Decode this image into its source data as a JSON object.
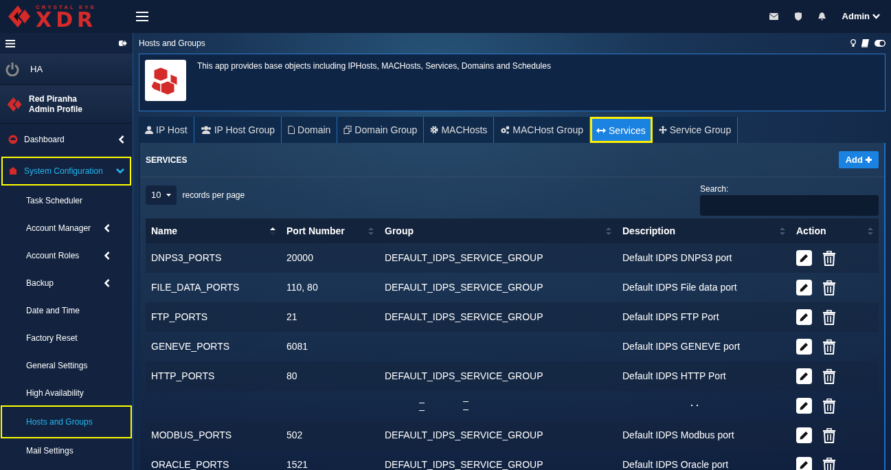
{
  "logo": {
    "top": "CRYSTAL EYE",
    "main": "XDR"
  },
  "topbar": {
    "user": "Admin"
  },
  "sidebar": {
    "ha": "HA",
    "profile": {
      "name": "Red Piranha",
      "role": "Admin Profile"
    },
    "items": [
      {
        "label": "Dashboard",
        "selected": false,
        "expanded": false,
        "has_children": true
      },
      {
        "label": "System Configuration",
        "selected": true,
        "expanded": true,
        "has_children": true,
        "children": [
          {
            "label": "Task Scheduler",
            "selected": false,
            "has_children": false
          },
          {
            "label": "Account Manager",
            "selected": false,
            "has_children": true
          },
          {
            "label": "Account Roles",
            "selected": false,
            "has_children": true
          },
          {
            "label": "Backup",
            "selected": false,
            "has_children": true
          },
          {
            "label": "Date and Time",
            "selected": false,
            "has_children": false
          },
          {
            "label": "Factory Reset",
            "selected": false,
            "has_children": false
          },
          {
            "label": "General Settings",
            "selected": false,
            "has_children": false
          },
          {
            "label": "High Availability",
            "selected": false,
            "has_children": false
          },
          {
            "label": "Hosts and Groups",
            "selected": true,
            "has_children": false
          },
          {
            "label": "Mail Settings",
            "selected": false,
            "has_children": false
          }
        ]
      }
    ]
  },
  "page": {
    "title": "Hosts and Groups",
    "info": "This app provides base objects including IPHosts, MACHosts, Services, Domains and Schedules"
  },
  "tabs": [
    {
      "label": "IP Host",
      "selected": false
    },
    {
      "label": "IP Host Group",
      "selected": false
    },
    {
      "label": "Domain",
      "selected": false
    },
    {
      "label": "Domain Group",
      "selected": false
    },
    {
      "label": "MACHosts",
      "selected": false
    },
    {
      "label": "MACHost Group",
      "selected": false
    },
    {
      "label": "Services",
      "selected": true
    },
    {
      "label": "Service Group",
      "selected": false
    }
  ],
  "panel": {
    "title": "SERVICES",
    "add_button": "Add",
    "page_size": "10",
    "page_size_label": "records per page",
    "search_label": "Search:"
  },
  "table": {
    "columns": [
      {
        "label": "Name",
        "sorted": true
      },
      {
        "label": "Port Number",
        "sorted": false
      },
      {
        "label": "Group",
        "sorted": false
      },
      {
        "label": "Description",
        "sorted": false
      },
      {
        "label": "Action",
        "sorted": false
      }
    ],
    "rows": [
      {
        "name": "DNPS3_PORTS",
        "port": "20000",
        "group": "DEFAULT_IDPS_SERVICE_GROUP",
        "description": "Default IDPS DNPS3 port"
      },
      {
        "name": "FILE_DATA_PORTS",
        "port": "110, 80",
        "group": "DEFAULT_IDPS_SERVICE_GROUP",
        "description": "Default IDPS File data port"
      },
      {
        "name": "FTP_PORTS",
        "port": "21",
        "group": "DEFAULT_IDPS_SERVICE_GROUP",
        "description": "Default IDPS FTP Port"
      },
      {
        "name": "GENEVE_PORTS",
        "port": "6081",
        "description": "Default IDPS GENEVE port"
      },
      {
        "name": "HTTP_PORTS",
        "port": "80",
        "group": "DEFAULT_IDPS_SERVICE_GROUP",
        "description": "Default IDPS HTTP Port"
      },
      {
        "redacted": true
      },
      {
        "name": "MODBUS_PORTS",
        "port": "502",
        "group": "DEFAULT_IDPS_SERVICE_GROUP",
        "description": "Default IDPS Modbus port"
      },
      {
        "name": "ORACLE_PORTS",
        "port": "1521",
        "group": "DEFAULT_IDPS_SERVICE_GROUP",
        "description": "Default IDPS Oracle port"
      }
    ]
  }
}
